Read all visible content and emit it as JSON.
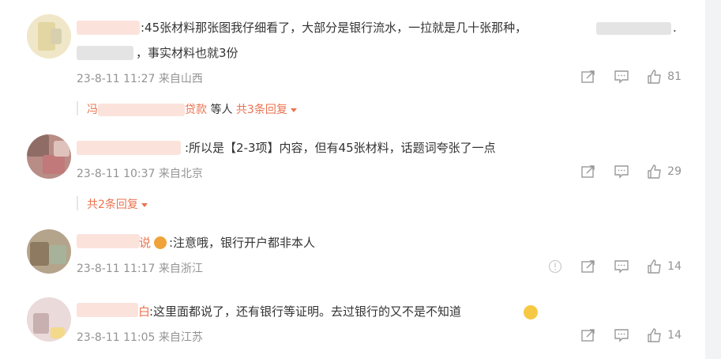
{
  "comments": [
    {
      "text_line1": ":45张材料那张图我仔细看了，大部分是银行流水，一拉就是几十张那种，",
      "text_line1_tail": ".",
      "text_line2": "，事实材料也就3份",
      "meta": "23-8-11 11:27 来自山西",
      "likes": "81",
      "reply_prefix": "冯",
      "reply_suffix": "贷款",
      "reply_others": "等人",
      "reply_count": "共3条回复"
    },
    {
      "text": ":所以是【2-3项】内容，但有45张材料，话题词夸张了一点",
      "meta": "23-8-11 10:37 来自北京",
      "likes": "29",
      "reply_count": "共2条回复"
    },
    {
      "name_tail": "说",
      "text": ":注意哦，银行开户都非本人",
      "meta": "23-8-11 11:17 来自浙江",
      "likes": "14"
    },
    {
      "name_tail": "白",
      "text": ":这里面都说了，还有银行等证明。去过银行的又不是不知道",
      "meta": "23-8-11 11:05 来自江苏",
      "likes": "14"
    }
  ],
  "icons": [
    "share-icon",
    "comment-icon",
    "like-icon",
    "report-icon",
    "emoji-icon"
  ],
  "colors": {
    "accent": "#eb7350",
    "meta": "#939393",
    "text": "#333333"
  }
}
